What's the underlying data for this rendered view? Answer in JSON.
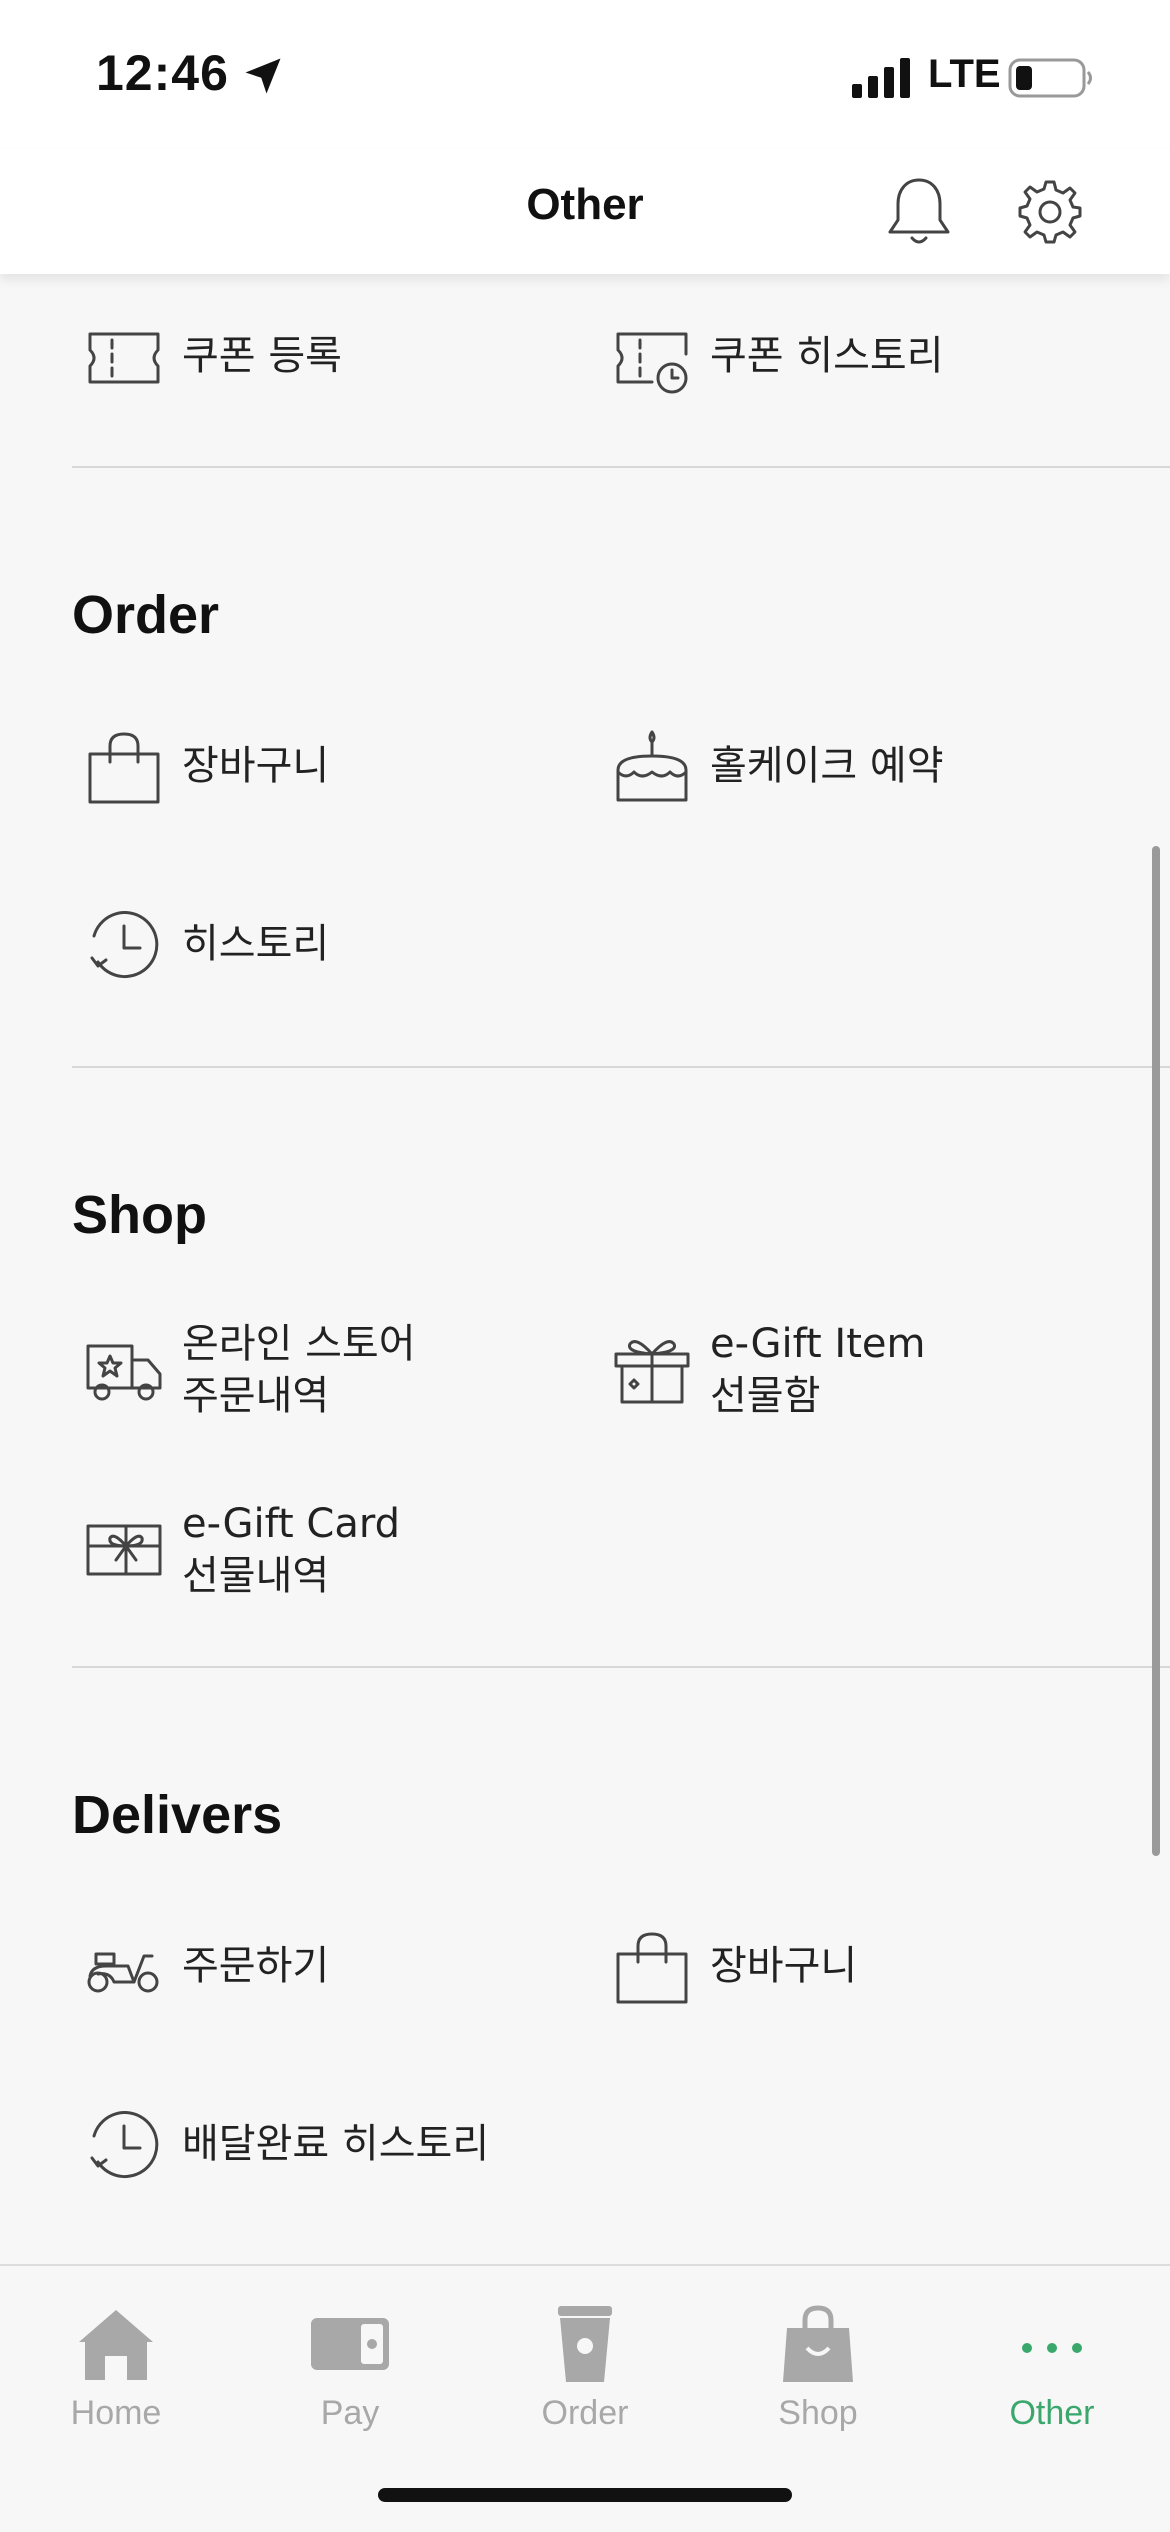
{
  "status_bar": {
    "time": "12:46",
    "network": "LTE"
  },
  "header": {
    "title": "Other"
  },
  "coupon": {
    "items": [
      {
        "label": "쿠폰 등록",
        "icon": "coupon-icon"
      },
      {
        "label": "쿠폰 히스토리",
        "icon": "coupon-history-icon"
      }
    ]
  },
  "order": {
    "title": "Order",
    "items": [
      {
        "label": "장바구니",
        "icon": "shopping-bag-icon"
      },
      {
        "label": "홀케이크 예약",
        "icon": "cake-icon"
      },
      {
        "label": "히스토리",
        "icon": "history-icon"
      }
    ]
  },
  "shop": {
    "title": "Shop",
    "items": [
      {
        "label": "온라인 스토어\n주문내역",
        "icon": "delivery-truck-icon"
      },
      {
        "label": "e-Gift Item\n선물함",
        "icon": "gift-box-icon"
      },
      {
        "label": "e-Gift Card\n선물내역",
        "icon": "gift-card-icon"
      }
    ]
  },
  "delivers": {
    "title": "Delivers",
    "items": [
      {
        "label": "주문하기",
        "icon": "scooter-icon"
      },
      {
        "label": "장바구니",
        "icon": "shopping-bag-icon"
      },
      {
        "label": "배달완료 히스토리",
        "icon": "history-icon"
      }
    ]
  },
  "tab_bar": {
    "tabs": [
      {
        "label": "Home",
        "icon": "home-icon",
        "active": false
      },
      {
        "label": "Pay",
        "icon": "card-icon",
        "active": false
      },
      {
        "label": "Order",
        "icon": "cup-icon",
        "active": false
      },
      {
        "label": "Shop",
        "icon": "bag-icon",
        "active": false
      },
      {
        "label": "Other",
        "icon": "more-dots-icon",
        "active": true
      }
    ]
  },
  "colors": {
    "accent": "#3aa86d",
    "inactive": "#a8a8a8",
    "background": "#f7f7f7"
  }
}
